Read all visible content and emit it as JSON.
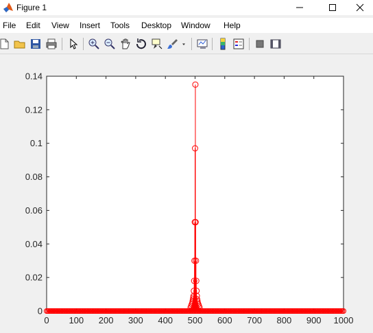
{
  "window": {
    "title": "Figure 1",
    "icon": "matlab-logo-icon"
  },
  "menu": {
    "items": [
      "File",
      "Edit",
      "View",
      "Insert",
      "Tools",
      "Desktop",
      "Window",
      "Help"
    ]
  },
  "toolbar": {
    "buttons": [
      "new-figure-icon",
      "open-file-icon",
      "save-icon",
      "print-icon",
      "pointer-icon",
      "zoom-in-icon",
      "zoom-out-icon",
      "pan-icon",
      "rotate-3d-icon",
      "data-cursor-icon",
      "brush-icon",
      "link-plot-icon",
      "colorbar-icon",
      "legend-icon",
      "hide-plot-tools-icon",
      "show-plot-tools-icon"
    ]
  },
  "chart_data": {
    "type": "stem",
    "title": "",
    "xlabel": "",
    "ylabel": "",
    "xlim": [
      0,
      1000
    ],
    "ylim": [
      0,
      0.14
    ],
    "xticks": [
      "0",
      "100",
      "200",
      "300",
      "400",
      "500",
      "600",
      "700",
      "800",
      "900",
      "1000"
    ],
    "yticks": [
      "0",
      "0.02",
      "0.04",
      "0.06",
      "0.08",
      "0.1",
      "0.12",
      "0.14"
    ],
    "color": "#ff0000",
    "marker": "circle",
    "grid": false,
    "series": [
      {
        "x": [
          485,
          487,
          489,
          491,
          492,
          493,
          494,
          495,
          496,
          497,
          498,
          499,
          500,
          501,
          502,
          503,
          504,
          505,
          506,
          507,
          508,
          509,
          511,
          513,
          515
        ],
        "values": [
          0.002,
          0.003,
          0.004,
          0.005,
          0.006,
          0.007,
          0.008,
          0.009,
          0.012,
          0.018,
          0.03,
          0.053,
          0.097,
          0.135,
          0.053,
          0.03,
          0.018,
          0.012,
          0.009,
          0.007,
          0.006,
          0.005,
          0.004,
          0.003,
          0.002
        ]
      }
    ]
  }
}
